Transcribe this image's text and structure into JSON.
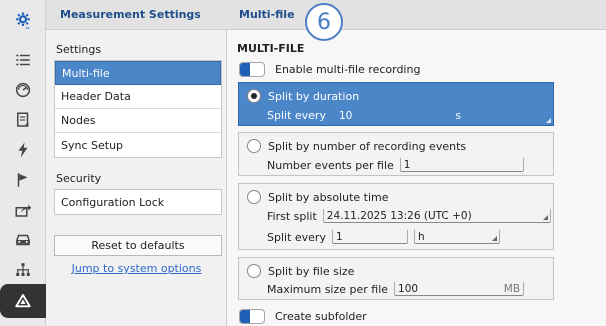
{
  "rail": {
    "icons": [
      "settings-gear-icon",
      "list-icon",
      "gauge-icon",
      "document-icon",
      "lightning-icon",
      "flag-icon",
      "export-icon",
      "car-icon",
      "network-icon",
      "alert-triangle-icon"
    ]
  },
  "nav": {
    "title": "Measurement Settings",
    "section_settings": "Settings",
    "items": [
      {
        "label": "Multi-file",
        "selected": true
      },
      {
        "label": "Header Data",
        "selected": false
      },
      {
        "label": "Nodes",
        "selected": false
      },
      {
        "label": "Sync Setup",
        "selected": false
      }
    ],
    "section_security": "Security",
    "security_items": [
      {
        "label": "Configuration Lock"
      }
    ],
    "reset_label": "Reset to defaults",
    "jump_link": "Jump to system options"
  },
  "main": {
    "title": "Multi-file",
    "badge": "6",
    "section_title": "MULTI-FILE",
    "enable_label": "Enable multi-file recording",
    "split_duration": {
      "label": "Split by duration",
      "field_label": "Split every",
      "value": "10",
      "unit": "s"
    },
    "split_events": {
      "label": "Split by number of recording events",
      "field_label": "Number events per file",
      "value": "1"
    },
    "split_time": {
      "label": "Split by absolute time",
      "first_label": "First split",
      "first_value": "24.11.2025 13:26 (UTC +0)",
      "every_label": "Split every",
      "every_value": "1",
      "every_unit": "h"
    },
    "split_size": {
      "label": "Split by file size",
      "field_label": "Maximum size per file",
      "value": "100",
      "unit": "MB"
    },
    "subfolder_label": "Create subfolder"
  },
  "colors": {
    "accent": "#4a86c8",
    "header_text": "#1f4e8c",
    "toggle_on": "#1f5fb8",
    "link": "#2f69c8"
  }
}
